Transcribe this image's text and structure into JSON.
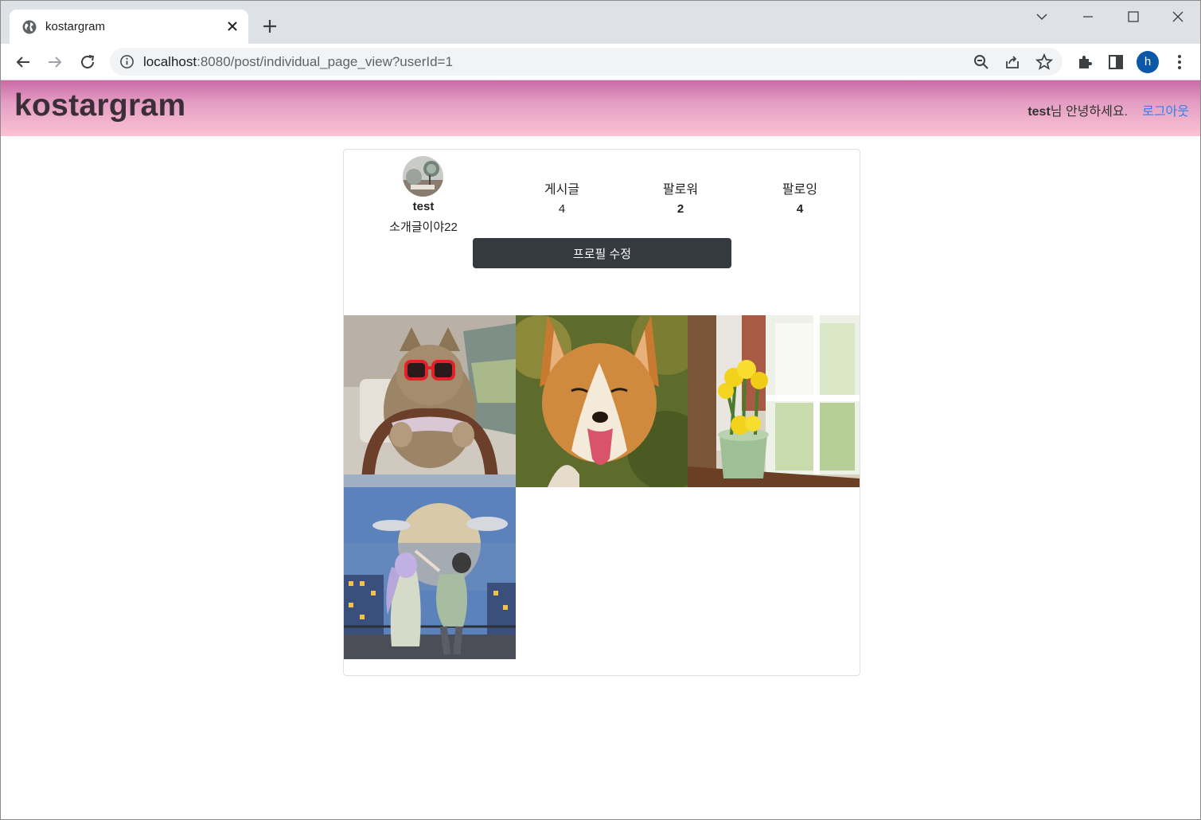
{
  "browser": {
    "tab_title": "kostargram",
    "url_host": "localhost",
    "url_rest": ":8080/post/individual_page_view?userId=1",
    "profile_initial": "h"
  },
  "header": {
    "brand": "kostargram",
    "greeting_user": "test",
    "greeting_suffix": "님 안녕하세요.",
    "logout_label": "로그아웃"
  },
  "profile": {
    "username": "test",
    "intro": "소개글이야22",
    "stats": [
      {
        "label": "게시글",
        "value": "4"
      },
      {
        "label": "팔로워",
        "value": "2"
      },
      {
        "label": "팔로잉",
        "value": "4"
      }
    ],
    "edit_button": "프로필 수정"
  },
  "posts": [
    {
      "subject": "cat-driving-photo"
    },
    {
      "subject": "corgi-dog-photo"
    },
    {
      "subject": "daffodil-pot-window-photo"
    },
    {
      "subject": "couple-dancing-illustration"
    }
  ],
  "colors": {
    "header_top": "#c86aa8",
    "header_bottom": "#fbc2d4",
    "edit_button_bg": "#343a40",
    "logout_link": "#2f80ed",
    "tabstrip_bg": "#dee1e6"
  }
}
